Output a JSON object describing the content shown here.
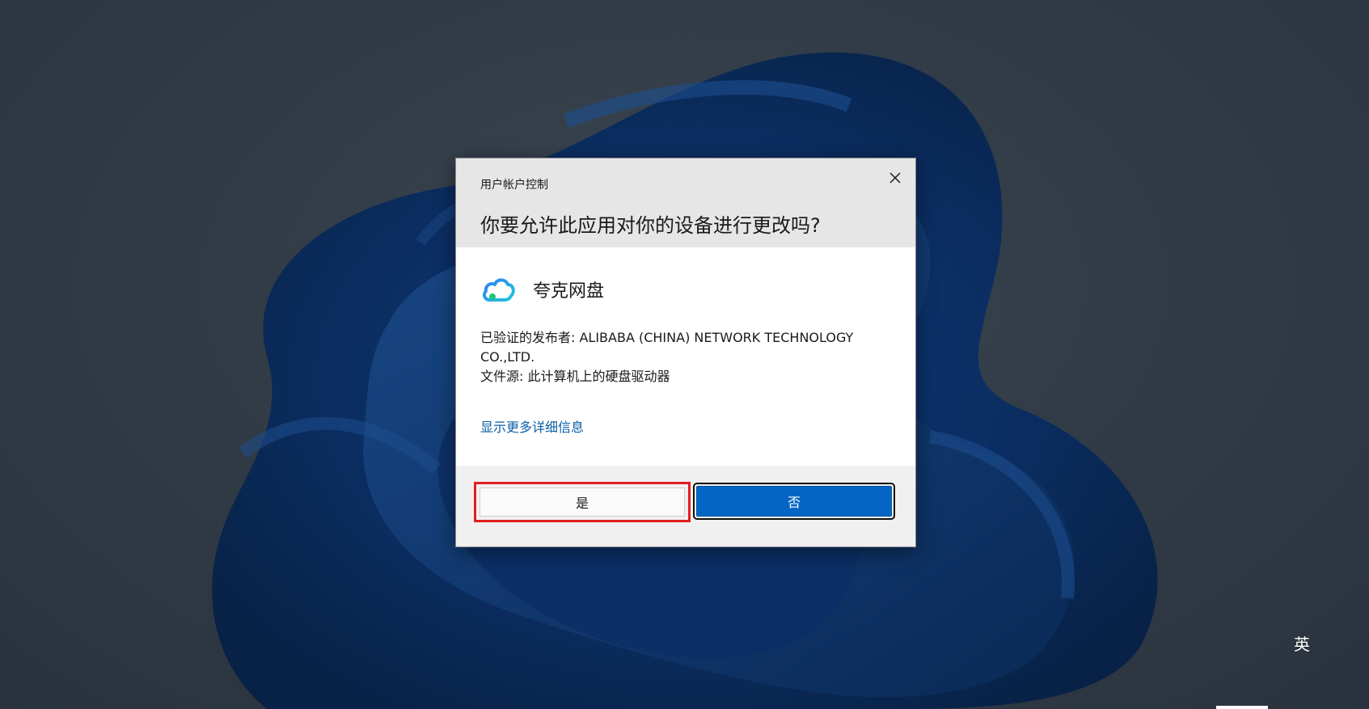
{
  "uac": {
    "window_title": "用户帐户控制",
    "question": "你要允许此应用对你的设备进行更改吗?",
    "app_name": "夸克网盘",
    "publisher_line": "已验证的发布者: ALIBABA (CHINA) NETWORK TECHNOLOGY CO.,LTD.",
    "file_origin_line": "文件源: 此计算机上的硬盘驱动器",
    "more_details_link": "显示更多详细信息",
    "yes_label": "是",
    "no_label": "否",
    "icons": {
      "close": "close-icon",
      "app": "quark-cloud-icon"
    },
    "colors": {
      "header_bg": "#e6e6e6",
      "link": "#0a5ea6",
      "primary_button": "#0366c4",
      "highlight": "#e01e1e"
    }
  },
  "system_tray": {
    "ime_label": "英"
  }
}
